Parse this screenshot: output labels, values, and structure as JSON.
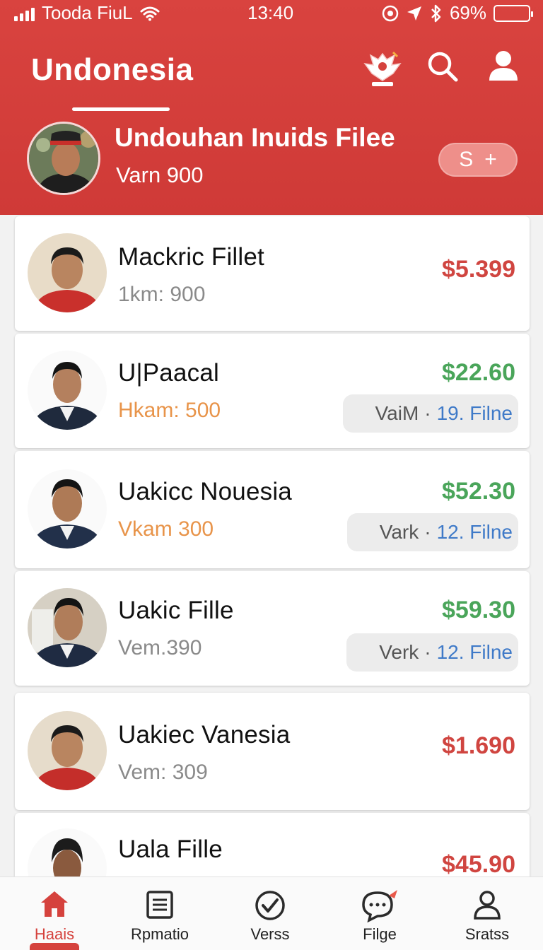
{
  "status": {
    "carrier": "Tooda FiuL",
    "time": "13:40",
    "battery": "69%",
    "battery_level": 0.9
  },
  "header": {
    "title": "Undonesia"
  },
  "profile": {
    "name": "Undouhan Inuids Filee",
    "subtitle": "Varn 900",
    "pill_letter": "S",
    "pill_plus": "+"
  },
  "list": [
    {
      "name": "Mackric Fillet",
      "sub": "1km: 900",
      "price": "$5.399",
      "price_color": "red"
    },
    {
      "name": "U|Paacal",
      "sub": "Hkam: 500",
      "price": "$22.60",
      "price_color": "green",
      "tag_text": "VaiM",
      "tag_num": "19. Filne"
    },
    {
      "name": "Uakicc Nouesia",
      "sub": "Vkam 300",
      "price": "$52.30",
      "price_color": "green",
      "tag_text": "Vark",
      "tag_num": "12. Filne"
    },
    {
      "name": "Uakic Fille",
      "sub": "Vem.390",
      "price": "$59.30",
      "price_color": "green",
      "tag_text": "Verk",
      "tag_num": "12. Filne"
    },
    {
      "name": "Uakiec Vanesia",
      "sub": "Vem: 309",
      "price": "$1.690",
      "price_color": "red"
    },
    {
      "name": "Uala Fille",
      "price": "$45.90",
      "price_color": "red"
    }
  ],
  "nav": [
    {
      "label": "Haais",
      "icon": "home-icon"
    },
    {
      "label": "Rpmatio",
      "icon": "document-icon"
    },
    {
      "label": "Verss",
      "icon": "check-circle-icon"
    },
    {
      "label": "Filge",
      "icon": "chat-icon"
    },
    {
      "label": "Sratss",
      "icon": "person-icon"
    }
  ],
  "colors": {
    "primary": "#d5423d",
    "price_red": "#d04540",
    "price_green": "#4aa55a",
    "tag_blue": "#3f7ac8"
  }
}
